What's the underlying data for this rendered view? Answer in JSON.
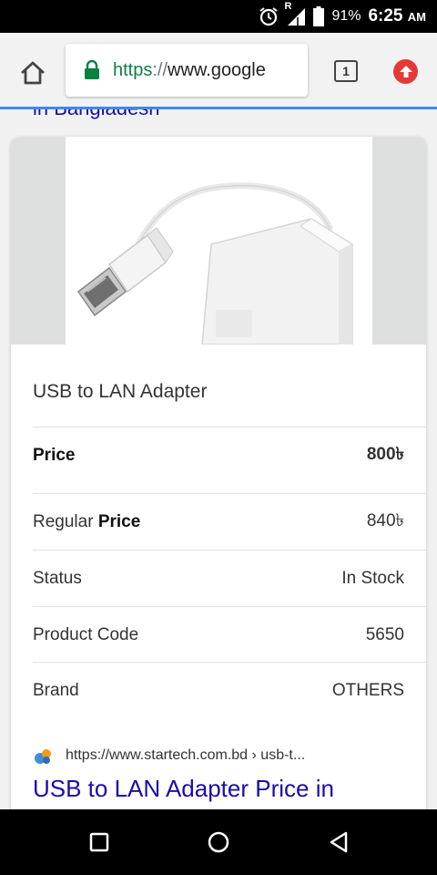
{
  "status_bar": {
    "battery": "91%",
    "time": "6:25",
    "ampm": "AM",
    "signal_badge": "R"
  },
  "toolbar": {
    "url_scheme": "https",
    "url_sep": "://",
    "url_host": "www.google",
    "tab_count": "1"
  },
  "page": {
    "prev_link_fragment": "in Bangladesh",
    "card": {
      "title": "USB to LAN Adapter",
      "rows": [
        {
          "label": "Price",
          "value": "800৳"
        },
        {
          "label_prefix": "Regular ",
          "label_bold": "Price",
          "value": "840৳"
        },
        {
          "label": "Status",
          "value": "In Stock"
        },
        {
          "label": "Product Code",
          "value": "5650"
        },
        {
          "label": "Brand",
          "value": "OTHERS"
        }
      ],
      "source_url": "https://www.startech.com.bd › usb-t...",
      "result_link": "USB to LAN Adapter Price in"
    }
  },
  "colors": {
    "link": "#1a0dab",
    "secure": "#0b8043",
    "update": "#e53935",
    "progress": "#4285f4"
  }
}
